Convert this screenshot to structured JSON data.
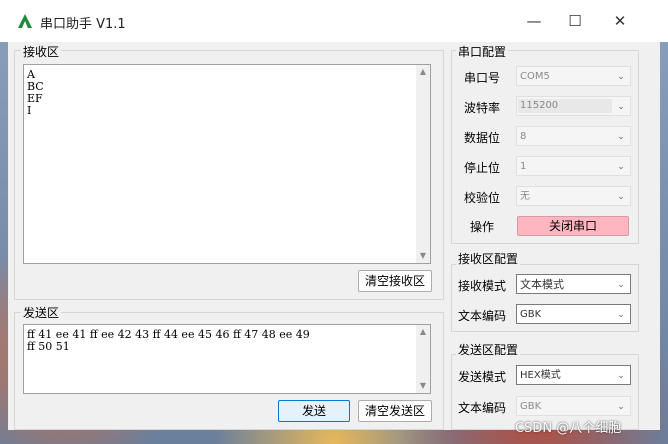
{
  "window": {
    "title": "串口助手 V1.1",
    "minimize_glyph": "—",
    "maximize_glyph": "☐",
    "close_glyph": "✕"
  },
  "receive": {
    "group_label": "接收区",
    "text": "A\nBC\nEF\nI",
    "clear_label": "清空接收区"
  },
  "send": {
    "group_label": "发送区",
    "text": "ff 41 ee 41 ff ee 42 43 ff 44 ee 45 46 ff 47 48 ee 49\nff 50 51",
    "send_label": "发送",
    "clear_label": "清空发送区"
  },
  "serial": {
    "group_label": "串口配置",
    "port_label": "串口号",
    "port_value": "COM5",
    "baud_label": "波特率",
    "baud_value": "115200",
    "databits_label": "数据位",
    "databits_value": "8",
    "stopbits_label": "停止位",
    "stopbits_value": "1",
    "parity_label": "校验位",
    "parity_value": "无",
    "action_label": "操作",
    "action_button": "关闭串口"
  },
  "recv_config": {
    "group_label": "接收区配置",
    "mode_label": "接收模式",
    "mode_value": "文本模式",
    "encoding_label": "文本编码",
    "encoding_value": "GBK"
  },
  "send_config": {
    "group_label": "发送区配置",
    "mode_label": "发送模式",
    "mode_value": "HEX模式",
    "encoding_label": "文本编码",
    "encoding_value": "GBK"
  },
  "watermark": "CSDN @八个细胞",
  "colors": {
    "close_button_bg": "#ffb6c1",
    "accent": "#0078d7"
  },
  "icons": [
    "app-icon",
    "minimize-icon",
    "maximize-icon",
    "close-icon",
    "chevron-down-icon",
    "scroll-up-icon",
    "scroll-down-icon"
  ]
}
